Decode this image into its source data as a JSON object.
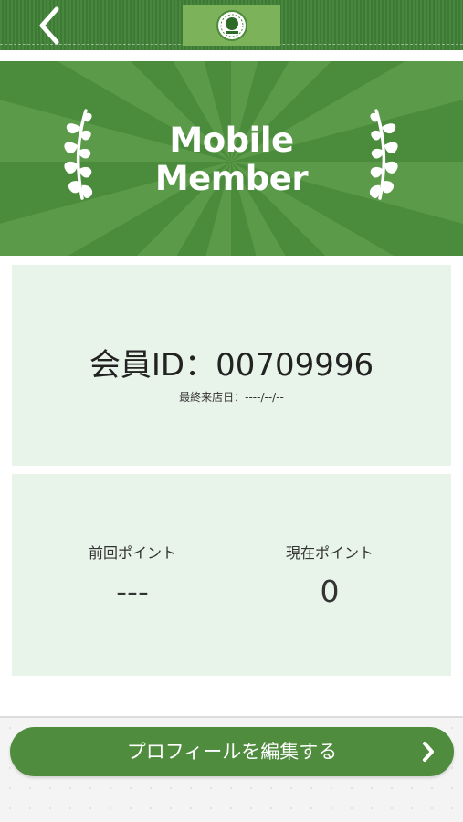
{
  "header": {
    "back_icon": "chevron-left-icon",
    "logo_icon": "club-emblem-icon"
  },
  "hero": {
    "title_line1": "Mobile",
    "title_line2": "Member",
    "left_icon": "laurel-branch-icon",
    "right_icon": "laurel-branch-icon"
  },
  "member": {
    "id_text": "会員ID：00709996",
    "last_visit": "最終来店日：----/--/--"
  },
  "points": {
    "previous_label": "前回ポイント",
    "previous_value": "---",
    "current_label": "現在ポイント",
    "current_value": "0"
  },
  "actions": {
    "edit_profile_label": "プロフィールを編集する",
    "edit_icon": "chevron-right-icon"
  },
  "colors": {
    "header_green": "#3f7f36",
    "hero_green": "#4a8c3b",
    "card_bg": "#e8f3ea",
    "button_green": "#4f8c3e"
  }
}
